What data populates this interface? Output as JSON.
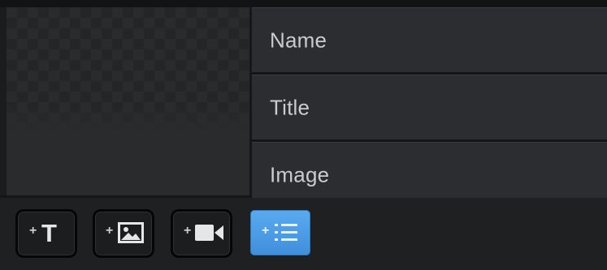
{
  "fields_panel": {
    "rows": [
      {
        "label": "Name"
      },
      {
        "label": "Title"
      },
      {
        "label": "Image"
      }
    ]
  },
  "toolbar": {
    "plus_sign": "+",
    "text_glyph": "T",
    "buttons": [
      {
        "icon": "add-text-icon",
        "active": false
      },
      {
        "icon": "add-image-icon",
        "active": false
      },
      {
        "icon": "add-video-icon",
        "active": false
      },
      {
        "icon": "add-list-icon",
        "active": true
      }
    ]
  },
  "colors": {
    "active_accent": "#4a9be6",
    "panel": "#2b2d30",
    "label_text": "#c9cbce"
  }
}
